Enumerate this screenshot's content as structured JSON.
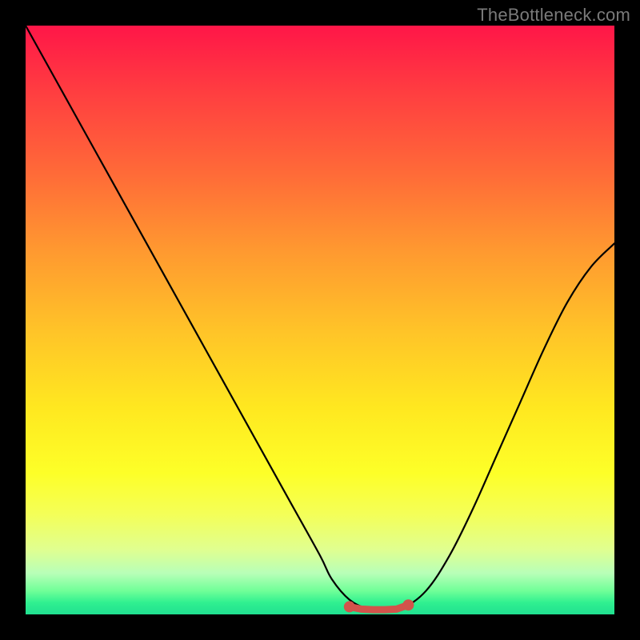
{
  "watermark": "TheBottleneck.com",
  "chart_data": {
    "type": "line",
    "title": "",
    "xlabel": "",
    "ylabel": "",
    "xlim": [
      0,
      100
    ],
    "ylim": [
      0,
      100
    ],
    "grid": false,
    "legend": null,
    "series": [
      {
        "name": "bottleneck-curve",
        "color": "#000000",
        "x": [
          0,
          5,
          10,
          15,
          20,
          25,
          30,
          35,
          40,
          45,
          50,
          52,
          55,
          58,
          60,
          62,
          64,
          68,
          72,
          76,
          80,
          84,
          88,
          92,
          96,
          100
        ],
        "y": [
          100,
          91,
          82,
          73,
          64,
          55,
          46,
          37,
          28,
          19,
          10,
          6,
          2.5,
          1,
          0.8,
          0.8,
          1,
          4,
          10,
          18,
          27,
          36,
          45,
          53,
          59,
          63
        ]
      },
      {
        "name": "optimal-flat-region",
        "color": "#d2534b",
        "x": [
          55,
          57,
          59,
          61,
          63,
          65
        ],
        "y": [
          1.3,
          0.9,
          0.8,
          0.8,
          0.9,
          1.6
        ]
      }
    ],
    "markers": [
      {
        "name": "optimal-point-left",
        "x": 55,
        "y": 1.3,
        "color": "#d2534b"
      },
      {
        "name": "optimal-point-right",
        "x": 65,
        "y": 1.6,
        "color": "#d2534b"
      }
    ]
  }
}
